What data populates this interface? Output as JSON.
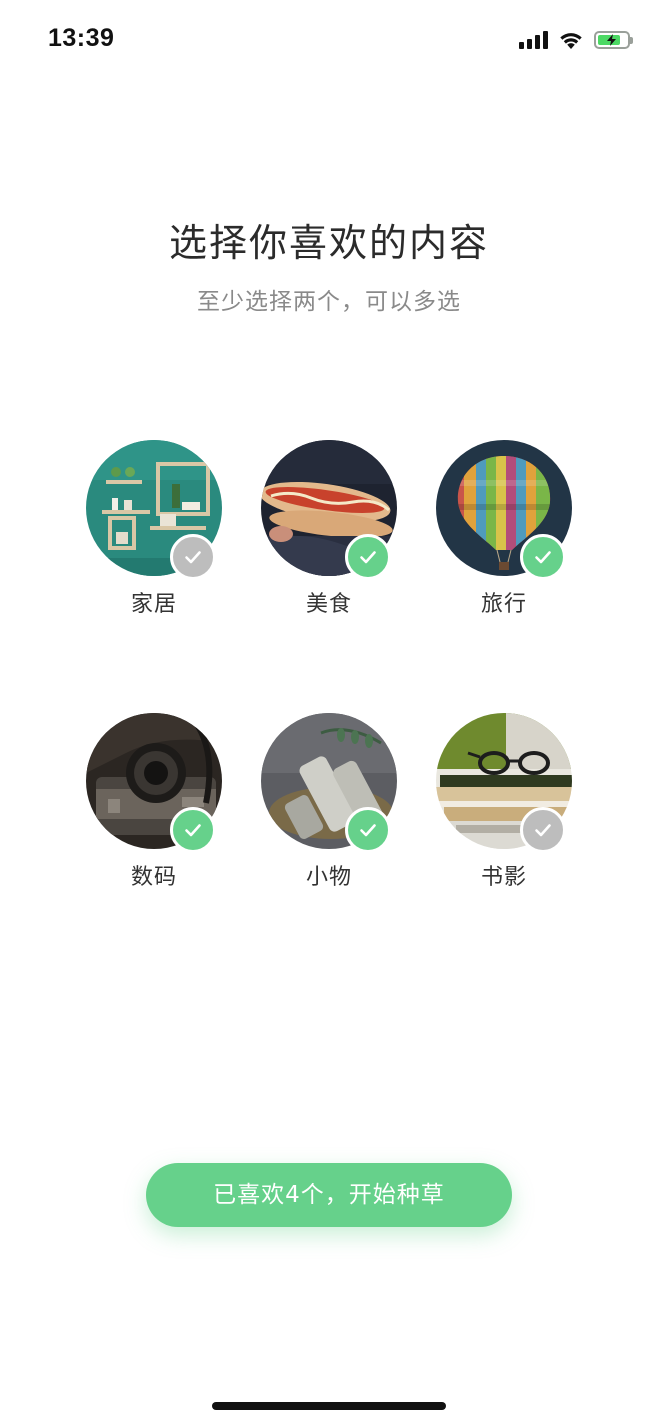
{
  "status_bar": {
    "time": "13:39",
    "icons": [
      "signal-icon",
      "wifi-icon",
      "battery-charging-icon"
    ]
  },
  "header": {
    "title": "选择你喜欢的内容",
    "subtitle": "至少选择两个，可以多选"
  },
  "categories": [
    {
      "label": "家居",
      "selected": false,
      "image": "home-shelves-photo"
    },
    {
      "label": "美食",
      "selected": true,
      "image": "hotdog-photo"
    },
    {
      "label": "旅行",
      "selected": true,
      "image": "hot-air-balloon-photo"
    },
    {
      "label": "数码",
      "selected": true,
      "image": "camera-photo"
    },
    {
      "label": "小物",
      "selected": true,
      "image": "cosmetics-photo"
    },
    {
      "label": "书影",
      "selected": false,
      "image": "books-glasses-photo"
    }
  ],
  "button": {
    "label": "已喜欢4个，开始种草"
  },
  "colors": {
    "accent": "#66d18b",
    "unselected": "#bdbdbd",
    "title": "#2b2b2b",
    "subtitle": "#8a8a8a"
  }
}
